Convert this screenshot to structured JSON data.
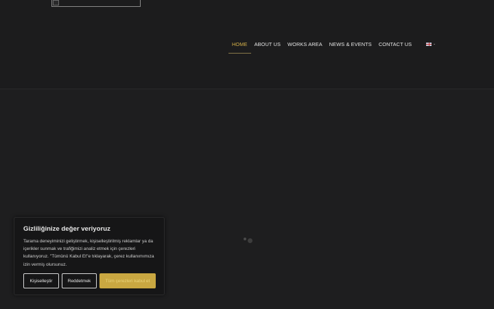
{
  "nav": {
    "items": [
      {
        "label": "HOME",
        "active": true
      },
      {
        "label": "ABOUT US",
        "active": false
      },
      {
        "label": "WORKS AREA",
        "active": false
      },
      {
        "label": "NEWS & EVENTS",
        "active": false
      },
      {
        "label": "CONTACT US",
        "active": false
      }
    ]
  },
  "language": {
    "icon": "uk-flag-icon",
    "chevron": "chevron-down-icon"
  },
  "loader": {
    "icon": "loading-dots-icon"
  },
  "cookie": {
    "title": "Gizliliğinize değer veriyoruz",
    "text": "Tarama deneyiminizi geliştirmek, kişiselleştirilmiş reklamlar ya da içerikler sunmak ve trafiğimizi analiz etmek için çerezleri kullanıyoruz. \"Tümünü Kabul Et\"e tıklayarak, çerez kullanımımıza izin vermiş olursunuz.",
    "buttons": {
      "customize": "Kişiselleştir",
      "reject": "Reddetmek",
      "accept": "Tüm çerezleri kabul et"
    }
  },
  "colors": {
    "background": "#1e1e1f",
    "accent": "#d6b24a",
    "accept_button": "#c9a741"
  }
}
